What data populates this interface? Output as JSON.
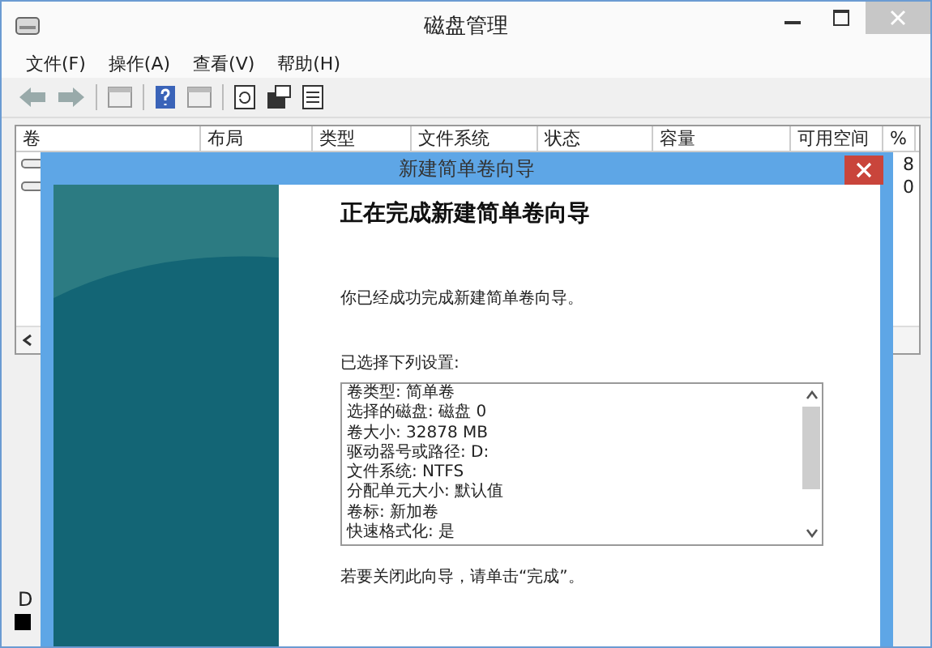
{
  "window": {
    "title": "磁盘管理"
  },
  "menu": [
    "文件(F)",
    "操作(A)",
    "查看(V)",
    "帮助(H)"
  ],
  "table": {
    "columns": [
      "卷",
      "布局",
      "类型",
      "文件系统",
      "状态",
      "容量",
      "可用空间",
      "%"
    ],
    "rows": [
      {
        "percent": "8"
      },
      {
        "percent": "0"
      }
    ]
  },
  "lower_pane": {
    "disk_label": "D"
  },
  "dialog": {
    "title": "新建简单卷向导",
    "heading": "正在完成新建简单卷向导",
    "message": "你已经成功完成新建简单卷向导。",
    "settings_label": "已选择下列设置:",
    "settings": [
      "卷类型: 简单卷",
      "选择的磁盘: 磁盘 0",
      "卷大小: 32878 MB",
      "驱动器号或路径: D:",
      "文件系统: NTFS",
      "分配单元大小: 默认值",
      "卷标: 新加卷",
      "快速格式化: 是"
    ],
    "footer": "若要关闭此向导，请单击“完成”。"
  }
}
